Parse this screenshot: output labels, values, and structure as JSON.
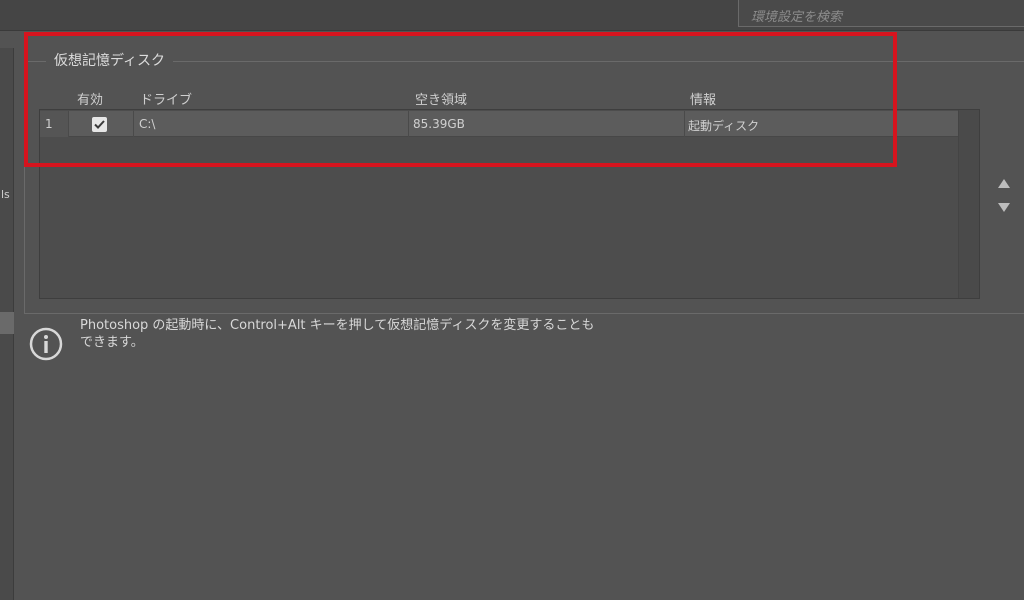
{
  "search": {
    "placeholder": "環境設定を検索"
  },
  "left_fragment": "ls",
  "group": {
    "title": "仮想記憶ディスク"
  },
  "table": {
    "columns": [
      "有効",
      "ドライブ",
      "空き領域",
      "情報"
    ],
    "rows": [
      {
        "index": "1",
        "enabled": true,
        "drive": "C:\\",
        "free": "85.39GB",
        "info": "起動ディスク"
      }
    ]
  },
  "info": {
    "text_line1": "Photoshop の起動時に、Control+Alt キーを押して仮想記憶ディスクを変更することも",
    "text_line2": "できます。"
  },
  "colors": {
    "highlight": "#d6141e",
    "background": "#535353"
  }
}
